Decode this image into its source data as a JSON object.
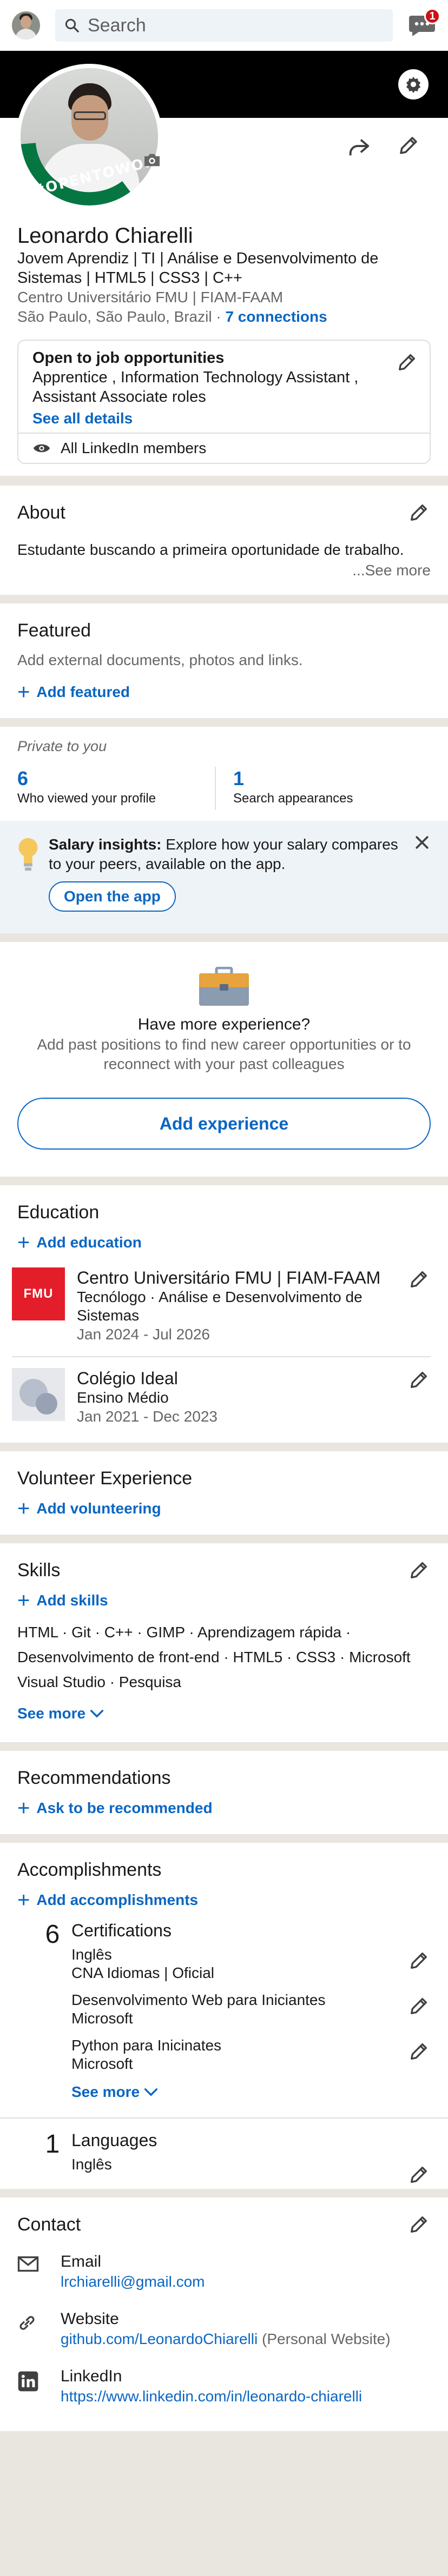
{
  "header": {
    "search_placeholder": "Search",
    "message_badge": "1"
  },
  "profile": {
    "frame_label": "#OPENTOWORK",
    "name": "Leonardo Chiarelli",
    "headline": "Jovem Aprendiz | TI | Análise e Desenvolvimento de Sistemas | HTML5 | CSS3 | C++",
    "education_line": "Centro Universitário FMU | FIAM-FAAM",
    "location": "São Paulo, São Paulo, Brazil",
    "separator": "·",
    "connections": "7 connections"
  },
  "open_to_work": {
    "title": "Open to job opportunities",
    "roles": "Apprentice , Information Technology Assistant , Assistant Associate roles",
    "see_all": "See all details",
    "visibility": "All LinkedIn members"
  },
  "about": {
    "title": "About",
    "text": "Estudante buscando a primeira oportunidade de trabalho.",
    "see_more": "...See more"
  },
  "featured": {
    "title": "Featured",
    "text": "Add external documents, photos and links.",
    "add": "Add featured"
  },
  "analytics": {
    "label": "Private to you",
    "items": [
      {
        "value": "6",
        "label": "Who viewed your profile"
      },
      {
        "value": "1",
        "label": "Search appearances"
      }
    ]
  },
  "salary": {
    "bold": "Salary insights:",
    "text": " Explore how your salary compares to your peers, available on the app.",
    "button": "Open the app"
  },
  "experience": {
    "title": "Have more experience?",
    "text": "Add past positions to find new career opportunities or to reconnect with your past colleagues",
    "button": "Add experience"
  },
  "education": {
    "title": "Education",
    "add": "Add education",
    "items": [
      {
        "logo": "FMU",
        "school": "Centro Universitário FMU | FIAM-FAAM",
        "degree": "Tecnólogo  ·  Análise e Desenvolvimento de Sistemas",
        "dates": "Jan 2024 - Jul 2026"
      },
      {
        "school": "Colégio Ideal",
        "degree": "Ensino Médio",
        "dates": "Jan 2021 - Dec 2023"
      }
    ]
  },
  "volunteer": {
    "title": "Volunteer Experience",
    "add": "Add volunteering"
  },
  "skills": {
    "title": "Skills",
    "add": "Add skills",
    "list": "HTML  ·  Git  ·  C++  ·  GIMP  ·  Aprendizagem rápida  ·  Desenvolvimento de front-end  ·  HTML5  ·  CSS3  ·  Microsoft Visual Studio  ·  Pesquisa",
    "see_more": "See more"
  },
  "recommendations": {
    "title": "Recommendations",
    "ask": "Ask to be recommended"
  },
  "accomplishments": {
    "title": "Accomplishments",
    "add": "Add accomplishments",
    "certifications": {
      "count": "6",
      "title": "Certifications",
      "items": [
        {
          "name": "Inglês",
          "org": "CNA Idiomas | Oficial"
        },
        {
          "name": "Desenvolvimento Web para Iniciantes",
          "org": "Microsoft"
        },
        {
          "name": "Python para Inicinates",
          "org": "Microsoft"
        }
      ],
      "see_more": "See more"
    },
    "languages": {
      "count": "1",
      "title": "Languages",
      "items": [
        {
          "name": "Inglês"
        }
      ]
    }
  },
  "contact": {
    "title": "Contact",
    "items": [
      {
        "label": "Email",
        "value": "lrchiarelli@gmail.com",
        "note": ""
      },
      {
        "label": "Website",
        "value": "github.com/LeonardoChiarelli",
        "note": " (Personal Website)"
      },
      {
        "label": "LinkedIn",
        "value": "https://www.linkedin.com/in/leonardo-chiarelli",
        "note": ""
      }
    ]
  },
  "icons": [
    "search-icon",
    "messages-icon",
    "settings-icon",
    "camera-icon",
    "share-icon",
    "pencil-icon",
    "eye-icon",
    "lightbulb-icon",
    "close-icon",
    "briefcase-icon",
    "plus-icon",
    "chevron-down-icon",
    "mail-icon",
    "link-icon",
    "linkedin-icon"
  ],
  "colors": {
    "accent": "#0a66c2",
    "open_to_work_green": "#057642",
    "fmu_red": "#e41d2a",
    "badge_red": "#cc1016"
  }
}
